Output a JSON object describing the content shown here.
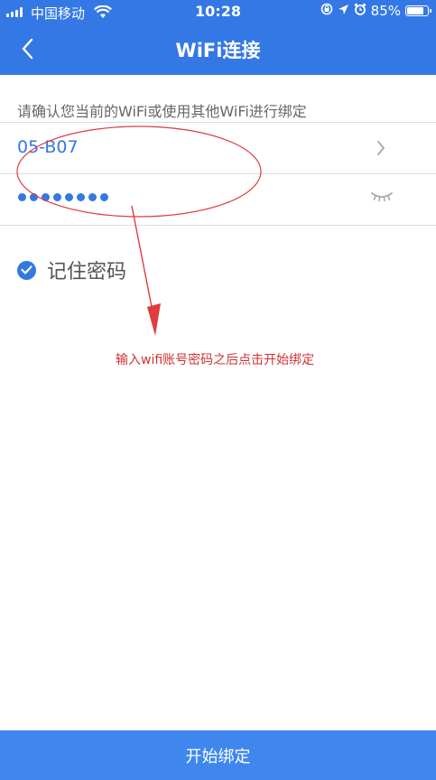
{
  "status_bar": {
    "carrier": "中国移动",
    "time": "10:28",
    "battery_percent": "85%",
    "battery_level": 0.85
  },
  "nav": {
    "title": "WiFi连接"
  },
  "form": {
    "hint": "请确认您当前的WiFi或使用其他WiFi进行绑定",
    "ssid": "05-B07",
    "password_dot_count": 8
  },
  "remember": {
    "label": "记住密码",
    "checked": true
  },
  "annotation": {
    "text": "输入wifi账号密码之后点击开始绑定",
    "color": "#d23232"
  },
  "footer": {
    "button_label": "开始绑定"
  },
  "colors": {
    "accent": "#3478e5",
    "button": "#3f87ef"
  },
  "icons": {
    "back": "chevron-left-icon",
    "ssid_action": "chevron-right-icon",
    "password_toggle": "eye-closed-icon",
    "remember": "check-circle-icon",
    "wifi": "wifi-icon"
  }
}
